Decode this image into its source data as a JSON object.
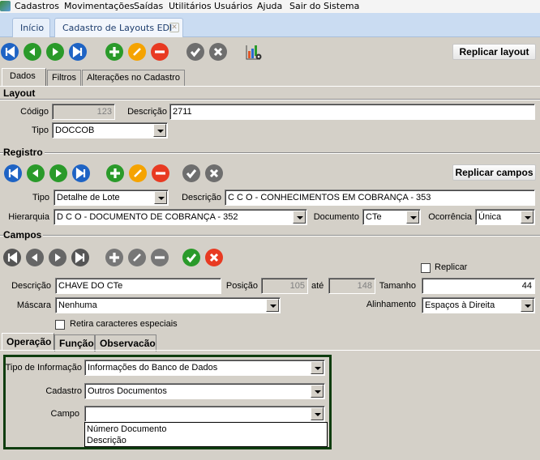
{
  "menu": {
    "items": [
      "Cadastros",
      "Movimentações",
      "Saídas",
      "Utilitários",
      "Usuários",
      "Ajuda",
      "Sair do Sistema"
    ]
  },
  "tabs": {
    "home": "Início",
    "active": "Cadastro de Layouts EDI"
  },
  "toolbar": {
    "icons": [
      "first-icon",
      "prev-icon",
      "next-icon",
      "last-icon",
      "add-icon",
      "edit-icon",
      "delete-icon",
      "confirm-icon",
      "cancel-icon",
      "report-icon"
    ],
    "replicar_layout": "Replicar layout"
  },
  "subtabs": [
    "Dados",
    "Filtros",
    "Alterações no Cadastro"
  ],
  "layout": {
    "title": "Layout",
    "codigo_label": "Código",
    "codigo": "123",
    "descricao_label": "Descrição",
    "descricao": "2711",
    "tipo_label": "Tipo",
    "tipo": "DOCCOB"
  },
  "registro": {
    "title": "Registro",
    "replicar_campos": "Replicar campos",
    "tipo_label": "Tipo",
    "tipo": "Detalhe de Lote",
    "descricao_label": "Descrição",
    "descricao": "C C O  - CONHECIMENTOS EM COBRANÇA - 353",
    "hierarquia_label": "Hierarquia",
    "hierarquia": "D C O  - DOCUMENTO DE COBRANÇA - 352",
    "documento_label": "Documento",
    "documento": "CTe",
    "ocorrencia_label": "Ocorrência",
    "ocorrencia": "Única"
  },
  "campos": {
    "title": "Campos",
    "replicar_label": "Replicar",
    "descricao_label": "Descrição",
    "descricao": "CHAVE DO CTe",
    "posicao_label": "Posição",
    "posicao": "105",
    "ate_label": "até",
    "ate": "148",
    "tamanho_label": "Tamanho",
    "tamanho": "44",
    "mascara_label": "Máscara",
    "mascara": "Nenhuma",
    "alinhamento_label": "Alinhamento",
    "alinhamento": "Espaços à Direita",
    "retira_label": "Retira caracteres especiais"
  },
  "optabs": [
    "Operação",
    "Função",
    "Observacão"
  ],
  "operacao": {
    "tipo_label": "Tipo de Informação",
    "tipo": "Informações do Banco de Dados",
    "cadastro_label": "Cadastro",
    "cadastro": "Outros Documentos",
    "campo_label": "Campo",
    "campo": "",
    "campo_options": [
      "Número Documento",
      "Descrição"
    ]
  },
  "colors": {
    "blue": "#1e63c4",
    "green": "#2a9a2a",
    "orange": "#f5a300",
    "red": "#e83a22",
    "gray": "#6e6e6e",
    "frame": "#0f3d0f"
  }
}
